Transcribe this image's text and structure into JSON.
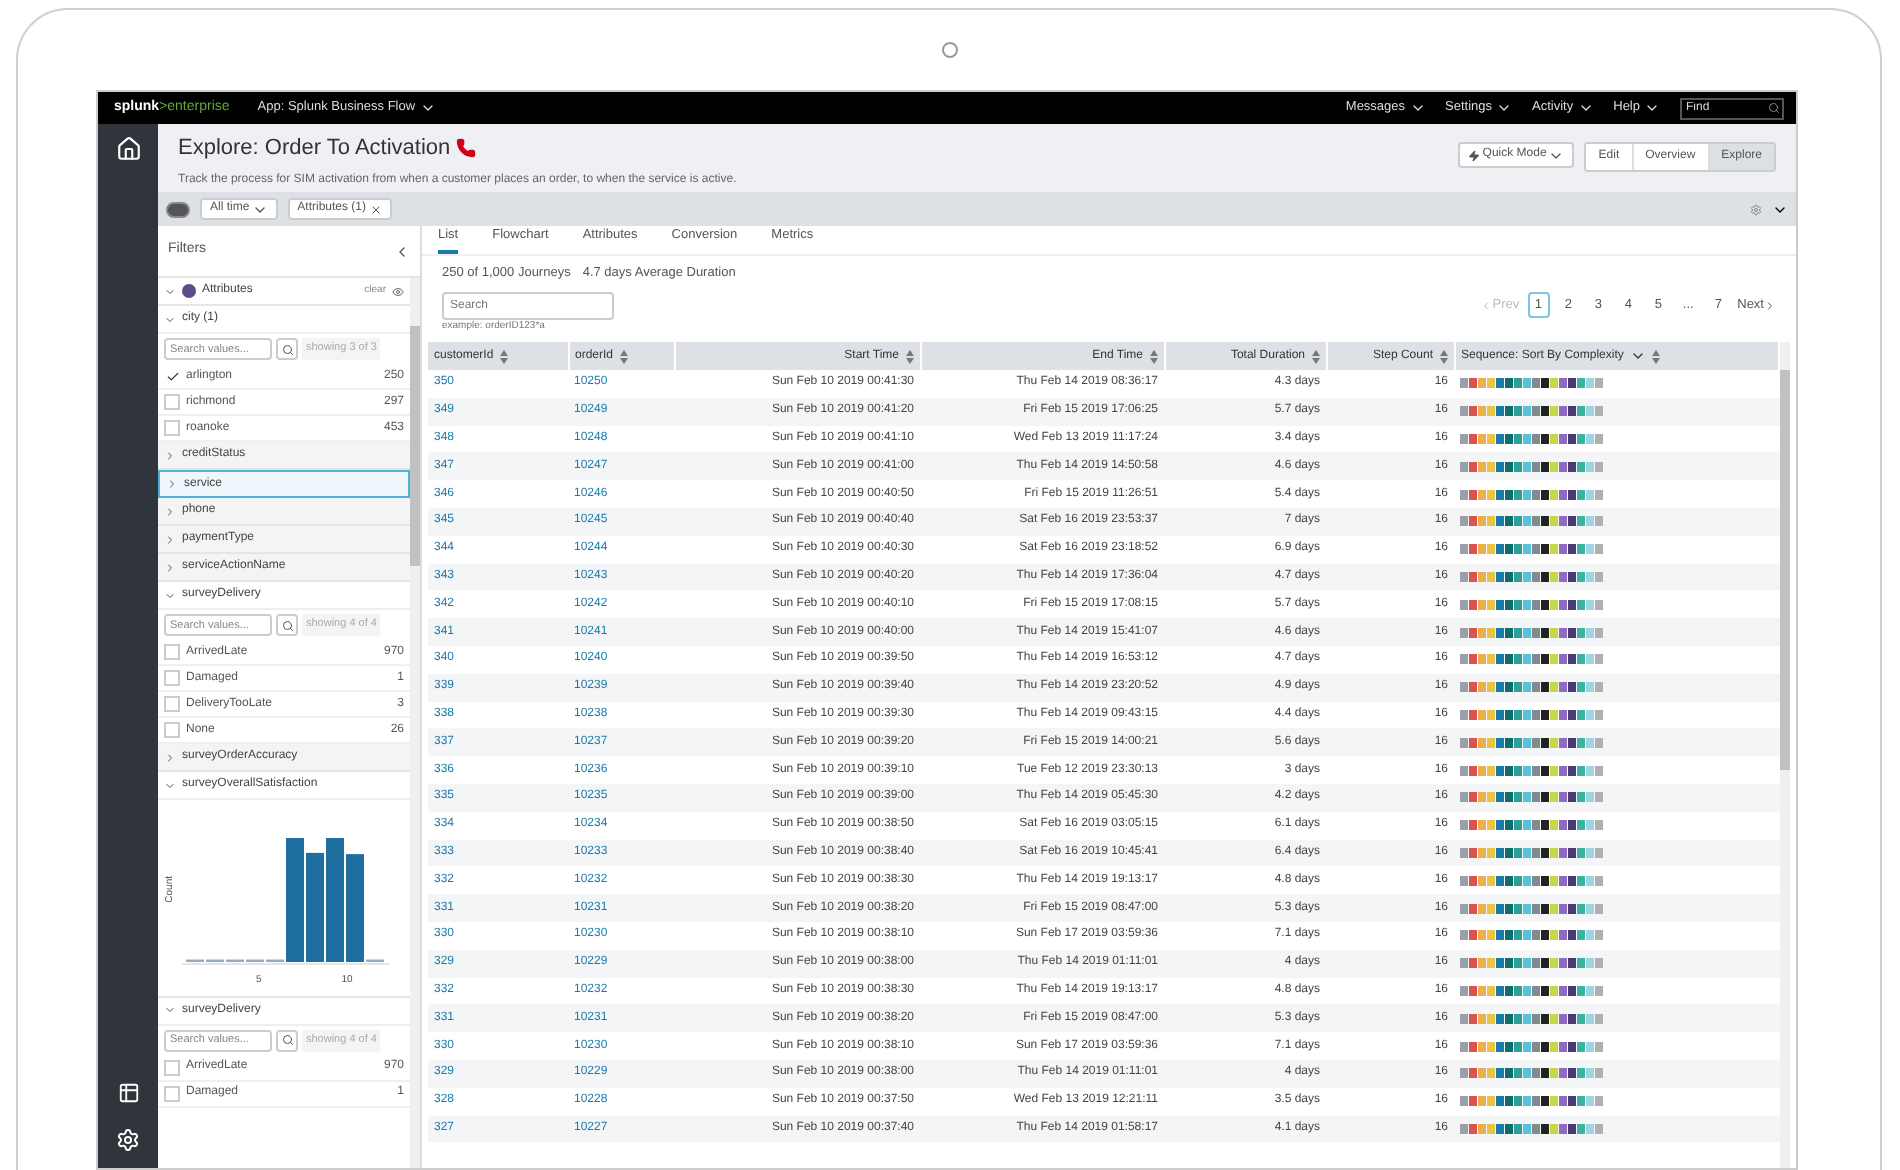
{
  "topbar": {
    "logo_main": "splunk",
    "logo_accent": ">enterprise",
    "app": "App: Splunk Business Flow",
    "menus": [
      "Messages",
      "Settings",
      "Activity",
      "Help"
    ],
    "find": {
      "placeholder": "Find"
    }
  },
  "header": {
    "title": "Explore: Order To Activation",
    "subtitle": "Track the process for SIM activation from when a customer places an order, to when the service is active.",
    "quick_mode": "Quick Mode",
    "views": [
      {
        "label": "Edit",
        "selected": false
      },
      {
        "label": "Overview",
        "selected": false
      },
      {
        "label": "Explore",
        "selected": true
      }
    ]
  },
  "filter_bar": {
    "time": "All time",
    "chip": "Attributes (1)"
  },
  "filters": {
    "title": "Filters",
    "sections": [
      {
        "kind": "group",
        "label": "Attributes",
        "action": "clear",
        "expanded": true
      },
      {
        "kind": "values",
        "label": "city (1)",
        "expanded": true,
        "selected": false,
        "search_placeholder": "Search values...",
        "showing": "showing 3 of 3",
        "values": [
          {
            "label": "arlington",
            "count": "250",
            "checked": true
          },
          {
            "label": "richmond",
            "count": "297",
            "checked": false
          },
          {
            "label": "roanoke",
            "count": "453",
            "checked": false
          }
        ]
      },
      {
        "kind": "field",
        "label": "creditStatus",
        "expanded": false,
        "selected": false
      },
      {
        "kind": "field",
        "label": "service",
        "expanded": false,
        "selected": true
      },
      {
        "kind": "field",
        "label": "phone",
        "expanded": false,
        "selected": false
      },
      {
        "kind": "field",
        "label": "paymentType",
        "expanded": false,
        "selected": false
      },
      {
        "kind": "field",
        "label": "serviceActionName",
        "expanded": false,
        "selected": false
      },
      {
        "kind": "values",
        "label": "surveyDelivery",
        "expanded": true,
        "selected": false,
        "search_placeholder": "Search values...",
        "showing": "showing 4 of 4",
        "values": [
          {
            "label": "ArrivedLate",
            "count": "970",
            "checked": false
          },
          {
            "label": "Damaged",
            "count": "1",
            "checked": false
          },
          {
            "label": "DeliveryTooLate",
            "count": "3",
            "checked": false
          },
          {
            "label": "None",
            "count": "26",
            "checked": false
          }
        ]
      },
      {
        "kind": "field",
        "label": "surveyOrderAccuracy",
        "expanded": false,
        "selected": false
      },
      {
        "kind": "histogram",
        "label": "surveyOverallSatisfaction",
        "expanded": true,
        "selected": false,
        "ylabel": "Count",
        "xticks": [
          "5",
          "10"
        ]
      },
      {
        "kind": "values",
        "label": "surveyDelivery",
        "expanded": true,
        "selected": false,
        "search_placeholder": "Search values...",
        "showing": "showing 4 of 4",
        "values": [
          {
            "label": "ArrivedLate",
            "count": "970",
            "checked": false
          },
          {
            "label": "Damaged",
            "count": "1",
            "checked": false
          }
        ]
      }
    ]
  },
  "tabs": [
    {
      "label": "List",
      "selected": true
    },
    {
      "label": "Flowchart",
      "selected": false
    },
    {
      "label": "Attributes",
      "selected": false
    },
    {
      "label": "Conversion",
      "selected": false
    },
    {
      "label": "Metrics",
      "selected": false
    }
  ],
  "summary": {
    "journeys": "250 of 1,000 Journeys",
    "duration": "4.7 days Average Duration"
  },
  "search": {
    "placeholder": "Search",
    "example": "example: orderID123*a"
  },
  "pagination": {
    "prev": {
      "label": "Prev",
      "disabled": true
    },
    "pages": [
      {
        "label": "1",
        "selected": true
      },
      {
        "label": "2",
        "selected": false
      },
      {
        "label": "3",
        "selected": false
      },
      {
        "label": "4",
        "selected": false
      },
      {
        "label": "5",
        "selected": false
      },
      {
        "label": "...",
        "selected": false
      },
      {
        "label": "7",
        "selected": false
      }
    ],
    "next": {
      "label": "Next",
      "disabled": false
    }
  },
  "table": {
    "columns": [
      "customerId",
      "orderId",
      "Start Time",
      "End Time",
      "Total Duration",
      "Step Count",
      "Sequence: Sort By Complexity"
    ],
    "rows": [
      [
        "350",
        "10250",
        "Sun Feb 10 2019 00:41:30",
        "Thu Feb 14 2019 08:36:17",
        "4.3 days",
        "16"
      ],
      [
        "349",
        "10249",
        "Sun Feb 10 2019 00:41:20",
        "Fri Feb 15 2019 17:06:25",
        "5.7 days",
        "16"
      ],
      [
        "348",
        "10248",
        "Sun Feb 10 2019 00:41:10",
        "Wed Feb 13 2019 11:17:24",
        "3.4 days",
        "16"
      ],
      [
        "347",
        "10247",
        "Sun Feb 10 2019 00:41:00",
        "Thu Feb 14 2019 14:50:58",
        "4.6 days",
        "16"
      ],
      [
        "346",
        "10246",
        "Sun Feb 10 2019 00:40:50",
        "Fri Feb 15 2019 11:26:51",
        "5.4 days",
        "16"
      ],
      [
        "345",
        "10245",
        "Sun Feb 10 2019 00:40:40",
        "Sat Feb 16 2019 23:53:37",
        "7 days",
        "16"
      ],
      [
        "344",
        "10244",
        "Sun Feb 10 2019 00:40:30",
        "Sat Feb 16 2019 23:18:52",
        "6.9 days",
        "16"
      ],
      [
        "343",
        "10243",
        "Sun Feb 10 2019 00:40:20",
        "Thu Feb 14 2019 17:36:04",
        "4.7 days",
        "16"
      ],
      [
        "342",
        "10242",
        "Sun Feb 10 2019 00:40:10",
        "Fri Feb 15 2019 17:08:15",
        "5.7 days",
        "16"
      ],
      [
        "341",
        "10241",
        "Sun Feb 10 2019 00:40:00",
        "Thu Feb 14 2019 15:41:07",
        "4.6 days",
        "16"
      ],
      [
        "340",
        "10240",
        "Sun Feb 10 2019 00:39:50",
        "Thu Feb 14 2019 16:53:12",
        "4.7 days",
        "16"
      ],
      [
        "339",
        "10239",
        "Sun Feb 10 2019 00:39:40",
        "Thu Feb 14 2019 23:20:52",
        "4.9 days",
        "16"
      ],
      [
        "338",
        "10238",
        "Sun Feb 10 2019 00:39:30",
        "Thu Feb 14 2019 09:43:15",
        "4.4 days",
        "16"
      ],
      [
        "337",
        "10237",
        "Sun Feb 10 2019 00:39:20",
        "Fri Feb 15 2019 14:00:21",
        "5.6 days",
        "16"
      ],
      [
        "336",
        "10236",
        "Sun Feb 10 2019 00:39:10",
        "Tue Feb 12 2019 23:30:13",
        "3 days",
        "16"
      ],
      [
        "335",
        "10235",
        "Sun Feb 10 2019 00:39:00",
        "Thu Feb 14 2019 05:45:30",
        "4.2 days",
        "16"
      ],
      [
        "334",
        "10234",
        "Sun Feb 10 2019 00:38:50",
        "Sat Feb 16 2019 03:05:15",
        "6.1 days",
        "16"
      ],
      [
        "333",
        "10233",
        "Sun Feb 10 2019 00:38:40",
        "Sat Feb 16 2019 10:45:41",
        "6.4 days",
        "16"
      ],
      [
        "332",
        "10232",
        "Sun Feb 10 2019 00:38:30",
        "Thu Feb 14 2019 19:13:17",
        "4.8 days",
        "16"
      ],
      [
        "331",
        "10231",
        "Sun Feb 10 2019 00:38:20",
        "Fri Feb 15 2019 08:47:00",
        "5.3 days",
        "16"
      ],
      [
        "330",
        "10230",
        "Sun Feb 10 2019 00:38:10",
        "Sun Feb 17 2019 03:59:36",
        "7.1 days",
        "16"
      ],
      [
        "329",
        "10229",
        "Sun Feb 10 2019 00:38:00",
        "Thu Feb 14 2019 01:11:01",
        "4 days",
        "16"
      ],
      [
        "332",
        "10232",
        "Sun Feb 10 2019 00:38:30",
        "Thu Feb 14 2019 19:13:17",
        "4.8 days",
        "16"
      ],
      [
        "331",
        "10231",
        "Sun Feb 10 2019 00:38:20",
        "Fri Feb 15 2019 08:47:00",
        "5.3 days",
        "16"
      ],
      [
        "330",
        "10230",
        "Sun Feb 10 2019 00:38:10",
        "Sun Feb 17 2019 03:59:36",
        "7.1 days",
        "16"
      ],
      [
        "329",
        "10229",
        "Sun Feb 10 2019 00:38:00",
        "Thu Feb 14 2019 01:11:01",
        "4 days",
        "16"
      ],
      [
        "328",
        "10228",
        "Sun Feb 10 2019 00:37:50",
        "Wed Feb 13 2019 12:21:11",
        "3.5 days",
        "16"
      ],
      [
        "327",
        "10227",
        "Sun Feb 10 2019 00:37:40",
        "Thu Feb 14 2019 01:58:17",
        "4.1 days",
        "16"
      ]
    ]
  }
}
